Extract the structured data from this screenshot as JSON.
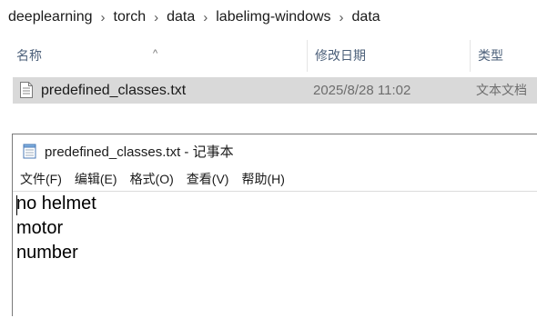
{
  "breadcrumb": {
    "items": [
      "deeplearning",
      "torch",
      "data",
      "labelimg-windows",
      "data"
    ]
  },
  "columns": {
    "name": "名称",
    "date": "修改日期",
    "type": "类型"
  },
  "file": {
    "name": "predefined_classes.txt",
    "date": "2025/8/28 11:02",
    "type": "文本文档"
  },
  "notepad": {
    "title": "predefined_classes.txt - 记事本",
    "menu": [
      "文件(F)",
      "编辑(E)",
      "格式(O)",
      "查看(V)",
      "帮助(H)"
    ],
    "lines": [
      "no helmet",
      "motor",
      "number"
    ]
  }
}
